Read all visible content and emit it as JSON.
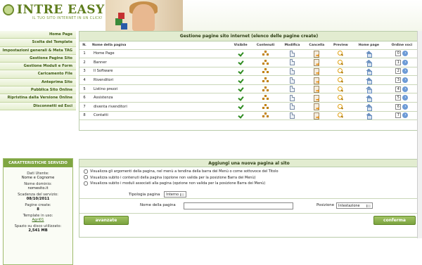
{
  "brand": {
    "name": "INTRE EASY SITO",
    "tagline": "IL TUO SITO INTERNET IN UN CLICK!"
  },
  "colors": {
    "accent": "#7fa642",
    "brand": "#5e7d1d",
    "border": "#b9ccaa"
  },
  "sidebar": {
    "items": [
      {
        "label": "Home Page"
      },
      {
        "label": "Scelta del Template"
      },
      {
        "label": "Impostazioni generali & Meta TAG"
      },
      {
        "label": "Gestione Pagine Sito"
      },
      {
        "label": "Gestione Moduli e Form"
      },
      {
        "label": "Caricamento File"
      },
      {
        "label": "Anteprima Sito"
      },
      {
        "label": "Pubblica Sito Online"
      },
      {
        "label": "Ripristina dalla Versione Online"
      },
      {
        "label": "Disconnetti ed Esci"
      }
    ]
  },
  "services": {
    "title": "CARATTERISTICHE SERVIZIO",
    "user_label": "Dati Utente:",
    "user_value": "Nome e Cognome",
    "domain_label": "Nome dominio:",
    "domain_value": "nomesito.it",
    "expiry_label": "Scadenza del servizio:",
    "expiry_value": "08/10/2011",
    "pages_label": "Pagine create:",
    "pages_value": "8",
    "template_label": "Template in uso:",
    "template_value": "Agri01",
    "space_label": "Spazio su disco utilizzato:",
    "space_value": "2,541 MB"
  },
  "pages": {
    "title": "Gestione pagine sito internet (elenco delle pagine create)",
    "headers": {
      "n": "N.",
      "name": "Nome della pagina",
      "visible": "Visibile",
      "content": "Contenuti",
      "edit": "Modifica",
      "delete": "Cancella",
      "preview": "Preview",
      "home": "Home page",
      "order": "Ordine voci"
    },
    "rows": [
      {
        "n": "1",
        "name": "Home Page",
        "order": "0"
      },
      {
        "n": "2",
        "name": "Banner",
        "order": "1"
      },
      {
        "n": "3",
        "name": "Il Software",
        "order": "2"
      },
      {
        "n": "4",
        "name": "Rivenditori",
        "order": "3"
      },
      {
        "n": "5",
        "name": "Listino prezzi",
        "order": "4"
      },
      {
        "n": "6",
        "name": "Assistenza",
        "order": "5"
      },
      {
        "n": "7",
        "name": "diventa rivenditori",
        "order": "6"
      },
      {
        "n": "8",
        "name": "Contatti",
        "order": "7"
      }
    ]
  },
  "add_page": {
    "title": "Aggiungi una nuova pagina al sito",
    "options": [
      "Visualizza gli argomenti della pagina, nel menù a tendina della barra dei Menù o come sottovoce del Titolo",
      "Visualizza subito i contenuti della pagina (opzione non valida per la posizione Barra dei Menù)",
      "Visualizza subito i moduli associati alla pagina (opzione non valida per la posizione Barra dei Menù)"
    ],
    "type_label": "Tipologia pagina",
    "type_value": "Interno",
    "name_label": "Nome della pagina",
    "name_value": "",
    "position_label": "Posizione",
    "position_value": "Intestazione",
    "advanced_label": "avanzate",
    "confirm_label": "conferma"
  }
}
